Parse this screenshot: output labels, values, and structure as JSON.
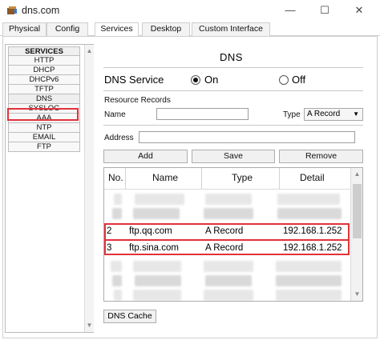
{
  "window": {
    "title": "dns.com",
    "minimize_glyph": "—",
    "maximize_glyph": "☐",
    "close_glyph": "✕"
  },
  "tabs": [
    {
      "label": "Physical"
    },
    {
      "label": "Config"
    },
    {
      "label": "Services",
      "active": true
    },
    {
      "label": "Desktop"
    },
    {
      "label": "Custom Interface"
    }
  ],
  "services": {
    "header": "SERVICES",
    "items": [
      "HTTP",
      "DHCP",
      "DHCPv6",
      "TFTP",
      "DNS",
      "SYSLOG",
      "AAA",
      "NTP",
      "EMAIL",
      "FTP"
    ],
    "selected": "DNS"
  },
  "dns": {
    "title": "DNS",
    "service_label": "DNS Service",
    "on_label": "On",
    "off_label": "Off",
    "state": "On",
    "resource_records_label": "Resource Records",
    "name_label": "Name",
    "name_value": "",
    "type_label": "Type",
    "type_value": "A Record",
    "address_label": "Address",
    "address_value": "",
    "add_button": "Add",
    "save_button": "Save",
    "remove_button": "Remove",
    "cache_button": "DNS Cache"
  },
  "table": {
    "headers": {
      "no": "No.",
      "name": "Name",
      "type": "Type",
      "detail": "Detail"
    },
    "rows": [
      {
        "no": "2",
        "name": "ftp.qq.com",
        "type": "A Record",
        "detail": "192.168.1.252"
      },
      {
        "no": "3",
        "name": "ftp.sina.com",
        "type": "A Record",
        "detail": "192.168.1.252"
      }
    ]
  },
  "colors": {
    "highlight": "#e2323a"
  }
}
